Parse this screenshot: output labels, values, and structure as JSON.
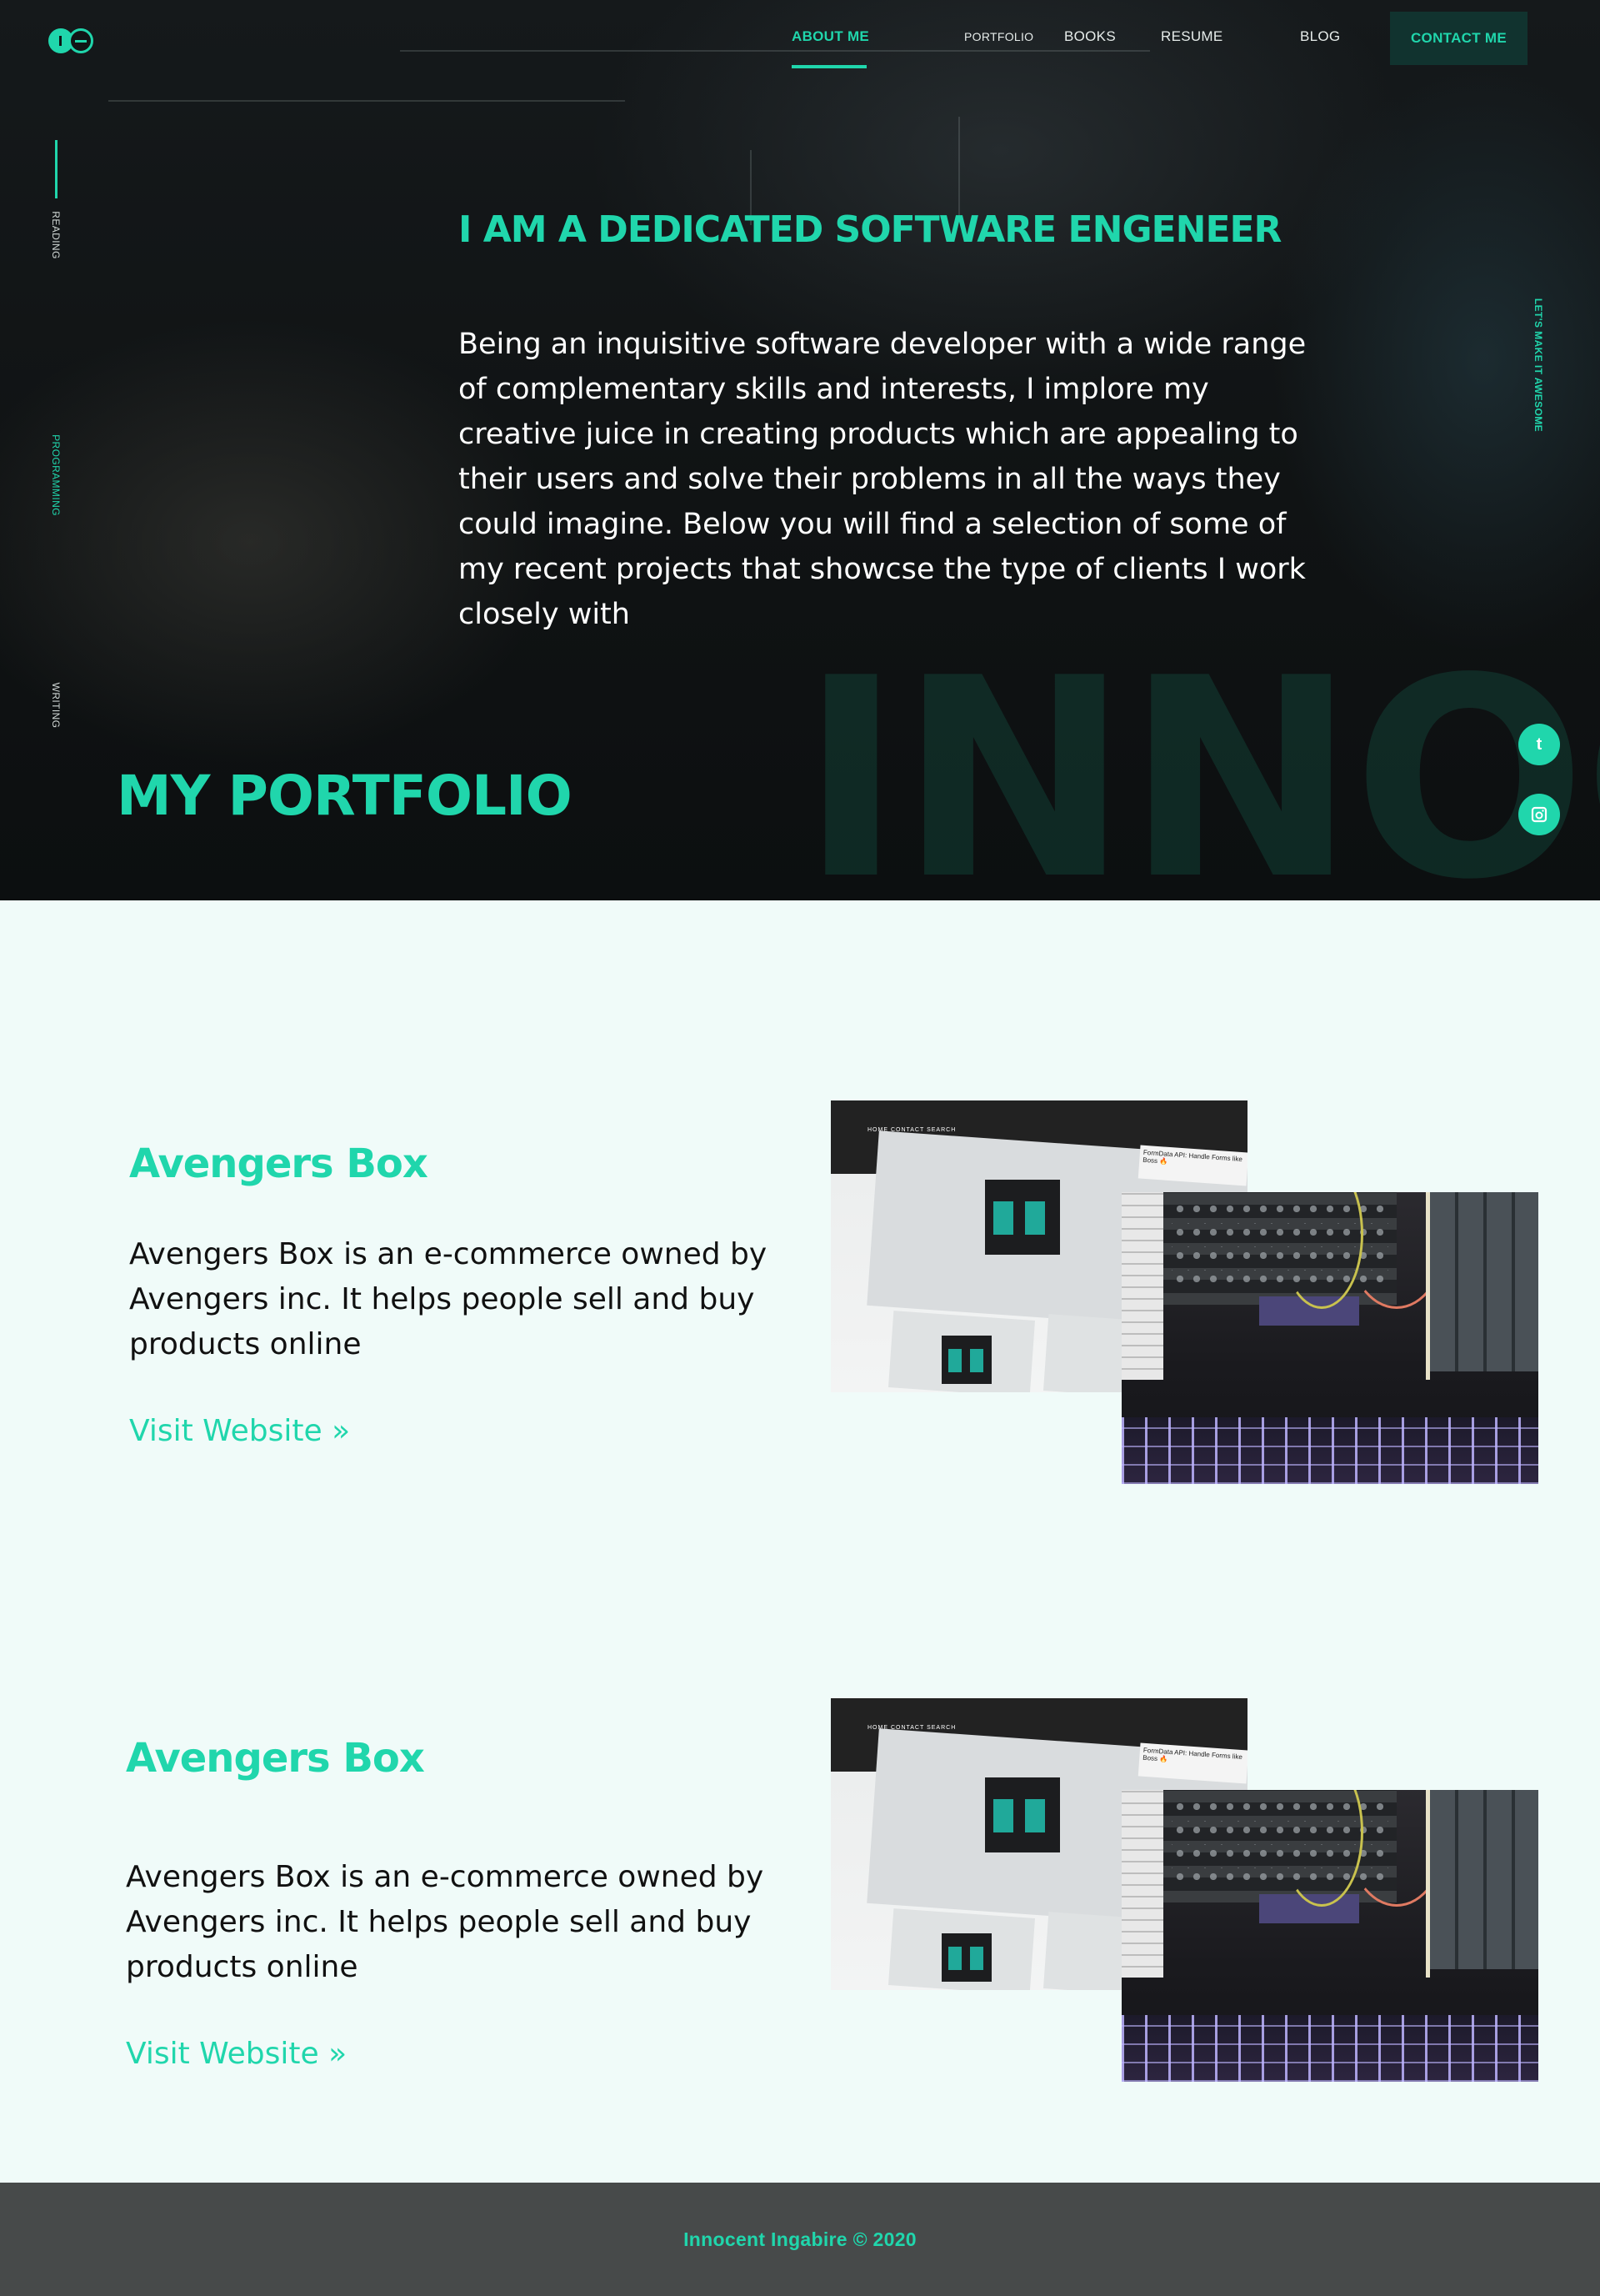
{
  "nav": {
    "items": [
      {
        "label": "ABOUT ME",
        "active": true
      },
      {
        "label": "PORTFOLIO",
        "active": false
      },
      {
        "label": "BOOKS",
        "active": false
      },
      {
        "label": "RESUME",
        "active": false
      },
      {
        "label": "BLOG",
        "active": false
      }
    ],
    "contact_label": "CONTACT ME"
  },
  "side_nav": {
    "items": [
      {
        "label": "READING",
        "active": true
      },
      {
        "label": "PROGRAMMING",
        "active": false
      },
      {
        "label": "WRITING",
        "active": false
      }
    ],
    "right_label": "LET'S MAKE IT AWESOME"
  },
  "hero": {
    "title": "I AM A DEDICATED SOFTWARE ENGENEER",
    "text": "Being an inquisitive software developer  with a wide range of complementary skills and interests, I implore my creative juice in creating products which are appealing to their users and solve their problems in all the ways they could imagine. Below you will find a selection of some of my recent projects that showcse the type of clients I work closely with",
    "watermark": "INNOC",
    "portfolio_heading": "MY PORTFOLIO"
  },
  "social": [
    {
      "icon": "tumblr-icon",
      "glyph": "t"
    },
    {
      "icon": "instagram-icon"
    }
  ],
  "projects": [
    {
      "name": "Avengers Box",
      "description": "Avengers Box  is an e-commerce owned by Avengers inc. It helps people sell and buy products online",
      "link_label": "Visit Website »",
      "screenshot_menu": "HOME   CONTACT   SEARCH",
      "screenshot_note": "FormData API: Handle Forms like Boss 🔥"
    },
    {
      "name": "Avengers Box",
      "description": "Avengers Box  is an e-commerce owned by Avengers inc. It helps people sell and buy products online",
      "link_label": "Visit Website »",
      "screenshot_menu": "HOME   CONTACT   SEARCH",
      "screenshot_note": "FormData API: Handle Forms like Boss 🔥"
    }
  ],
  "footer": {
    "text": "Innocent Ingabire  © 2020"
  },
  "colors": {
    "accent": "#20d6ac",
    "hero_bg": "#111516",
    "section_bg": "#f0fbf9",
    "footer_bg": "#474a4a"
  }
}
